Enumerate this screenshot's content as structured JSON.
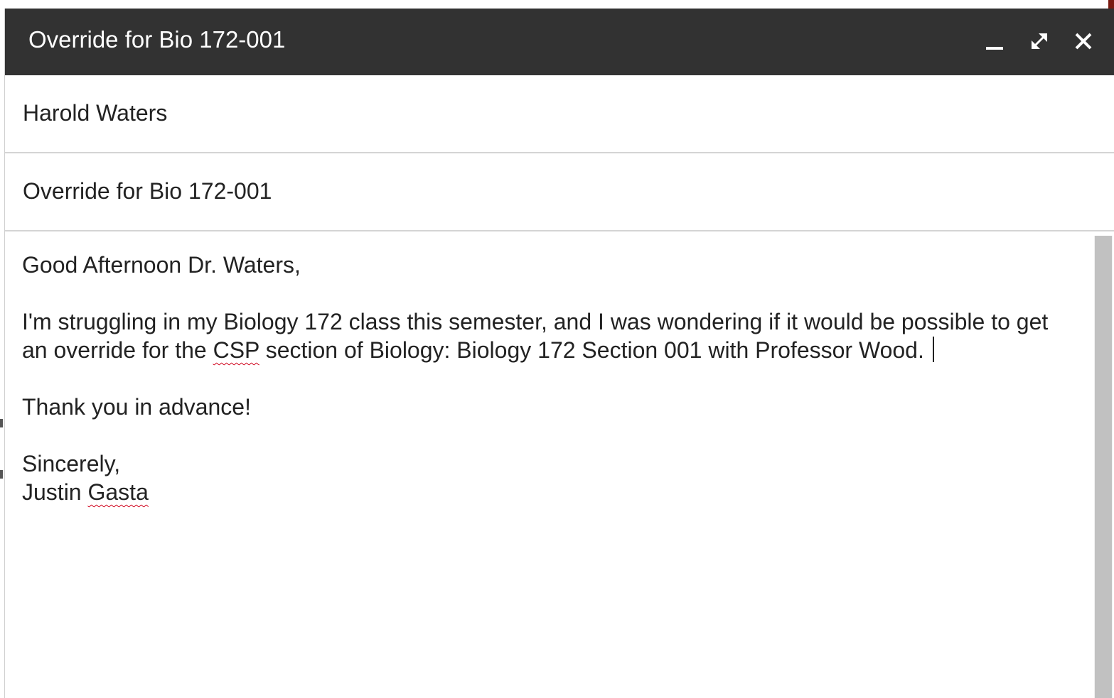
{
  "window": {
    "title": "Override for Bio 172-001",
    "controls": {
      "minimize": "minimize-icon",
      "expand": "expand-icon",
      "close": "close-icon"
    }
  },
  "compose": {
    "to": "Harold Waters",
    "subject": "Override for Bio 172-001",
    "body": {
      "greeting": "Good Afternoon Dr. Waters,",
      "paragraph_part1": "I'm struggling in my Biology 172 class this semester, and I was wondering if it would be possible to get an override for the ",
      "paragraph_flagged": "CSP",
      "paragraph_part2": " section of Biology: Biology 172 Section 001 with Professor Wood.",
      "thanks": "Thank you in advance!",
      "closing": "Sincerely,",
      "signature_first": "Justin ",
      "signature_last": "Gasta"
    }
  },
  "colors": {
    "titlebar": "#323232",
    "text": "#222222",
    "divider": "#d4d4d4",
    "spellcheck": "#d0021b",
    "scrollbar_thumb": "#c1c1c1"
  }
}
